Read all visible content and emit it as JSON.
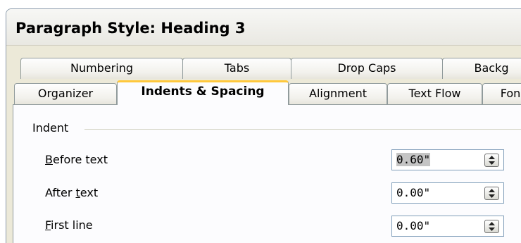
{
  "window": {
    "title": "Paragraph Style: Heading 3"
  },
  "tabs_row_back": [
    "Numbering",
    "Tabs",
    "Drop Caps",
    "Backg"
  ],
  "tabs_row_front": [
    "Organizer",
    "Indents & Spacing",
    "Alignment",
    "Text Flow",
    "Fon"
  ],
  "active_tab": "Indents & Spacing",
  "indent": {
    "group_label": "Indent",
    "fields": [
      {
        "label_mnemonic": "B",
        "label_rest": "efore text",
        "value": "0.60\"",
        "selected": true
      },
      {
        "label_pre": "After ",
        "label_mnemonic": "t",
        "label_rest": "ext",
        "value": "0.00\""
      },
      {
        "label_mnemonic": "F",
        "label_rest": "irst line",
        "value": "0.00\""
      }
    ]
  },
  "colors": {
    "active_tab_accent": "#ffc83c",
    "dialog_bg": "#ece9d8",
    "input_border": "#7f9db9"
  }
}
